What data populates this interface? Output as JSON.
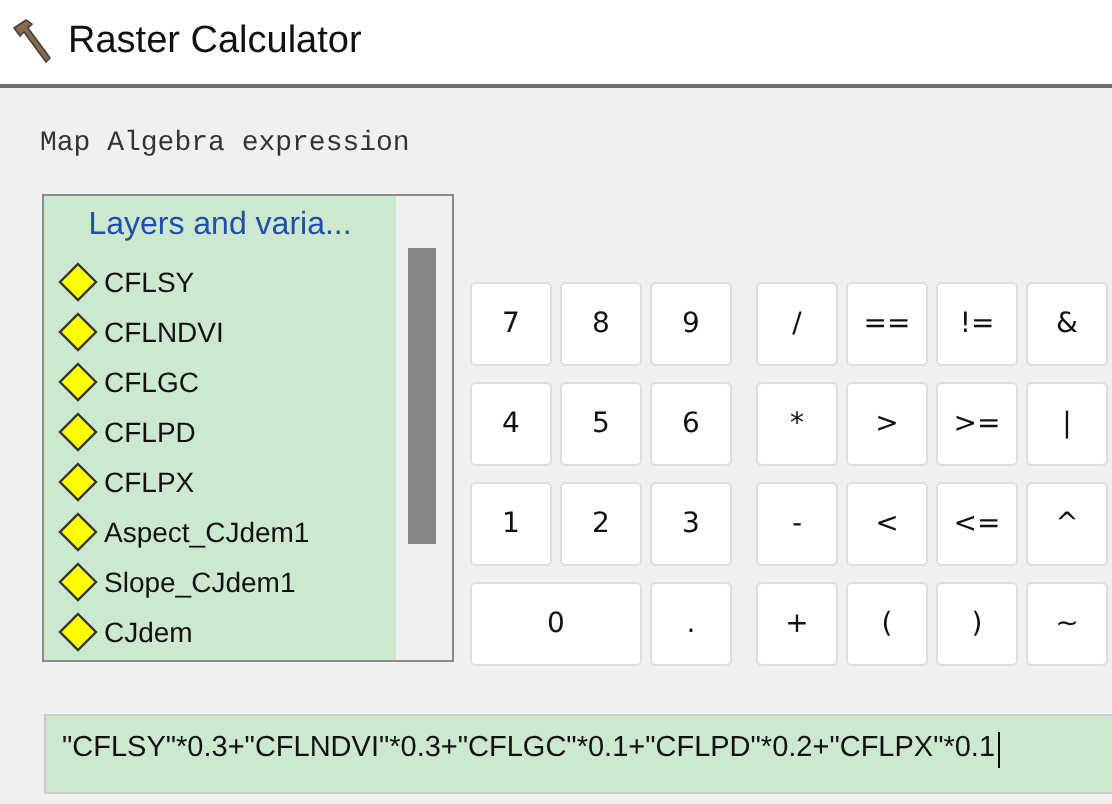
{
  "window": {
    "title": "Raster Calculator"
  },
  "expression_label": "Map Algebra expression",
  "layers": {
    "header": "Layers and varia...",
    "items": [
      {
        "label": "CFLSY"
      },
      {
        "label": "CFLNDVI"
      },
      {
        "label": "CFLGC"
      },
      {
        "label": "CFLPD"
      },
      {
        "label": "CFLPX"
      },
      {
        "label": "Aspect_CJdem1"
      },
      {
        "label": "Slope_CJdem1"
      },
      {
        "label": "CJdem"
      }
    ]
  },
  "digit_keys": [
    [
      {
        "label": "7",
        "kind": "normal"
      },
      {
        "label": "8",
        "kind": "normal"
      },
      {
        "label": "9",
        "kind": "normal"
      }
    ],
    [
      {
        "label": "4",
        "kind": "normal"
      },
      {
        "label": "5",
        "kind": "normal"
      },
      {
        "label": "6",
        "kind": "normal"
      }
    ],
    [
      {
        "label": "1",
        "kind": "normal"
      },
      {
        "label": "2",
        "kind": "normal"
      },
      {
        "label": "3",
        "kind": "normal"
      }
    ],
    [
      {
        "label": "0",
        "kind": "wide"
      },
      {
        "label": ".",
        "kind": "normal"
      }
    ]
  ],
  "operator_keys": [
    [
      {
        "label": "/"
      },
      {
        "label": "=="
      },
      {
        "label": "!="
      },
      {
        "label": "&"
      }
    ],
    [
      {
        "label": "*"
      },
      {
        "label": ">"
      },
      {
        "label": ">="
      },
      {
        "label": "|"
      }
    ],
    [
      {
        "label": "-"
      },
      {
        "label": "<"
      },
      {
        "label": "<="
      },
      {
        "label": "^"
      }
    ],
    [
      {
        "label": "+"
      },
      {
        "label": "("
      },
      {
        "label": ")"
      },
      {
        "label": "~"
      }
    ]
  ],
  "expression": {
    "value": "\"CFLSY\"*0.3+\"CFLNDVI\"*0.3+\"CFLGC\"*0.1+\"CFLPD\"*0.2+\"CFLPX\"*0.1",
    "focused": true
  }
}
